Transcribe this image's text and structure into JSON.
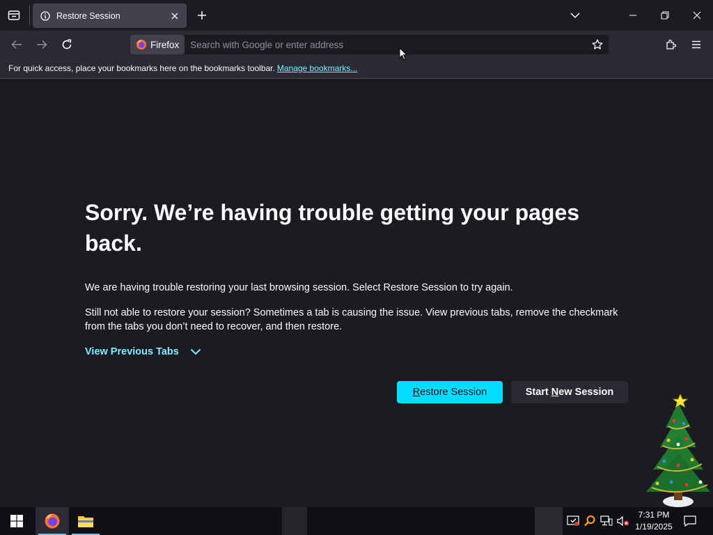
{
  "browser": {
    "tab": {
      "title": "Restore Session"
    },
    "urlbar": {
      "identity_label": "Firefox",
      "placeholder": "Search with Google or enter address"
    },
    "bookmarks_bar": {
      "text": "For quick access, place your bookmarks here on the bookmarks toolbar.",
      "link": "Manage bookmarks..."
    }
  },
  "page": {
    "heading": "Sorry. We’re having trouble getting your pages back.",
    "paragraph1": "We are having trouble restoring your last browsing session. Select Restore Session to try again.",
    "paragraph2": "Still not able to restore your session? Sometimes a tab is causing the issue. View previous tabs, remove the checkmark from the tabs you don’t need to recover, and then restore.",
    "view_previous_tabs": "View Previous Tabs",
    "restore_button": {
      "accesskey": "R",
      "rest": "estore Session"
    },
    "new_session_button": {
      "before": "Start ",
      "accesskey": "N",
      "after": "ew Session"
    }
  },
  "taskbar": {
    "clock_time": "7:31 PM",
    "clock_date": "1/19/2025"
  },
  "colors": {
    "accent": "#00ddff",
    "link": "#80ebff",
    "background": "#1c1b22",
    "toolbar": "#2b2a33"
  },
  "icons": [
    "tab-list-icon",
    "info-icon",
    "close-icon",
    "plus-icon",
    "chevron-down-icon",
    "minimize-icon",
    "restore-icon",
    "back-arrow-icon",
    "forward-arrow-icon",
    "reload-icon",
    "firefox-logo-icon",
    "star-icon",
    "extensions-icon",
    "menu-icon",
    "windows-start-icon",
    "file-explorer-icon",
    "security-icon",
    "search-icon",
    "network-icon",
    "volume-muted-icon",
    "notification-icon"
  ]
}
